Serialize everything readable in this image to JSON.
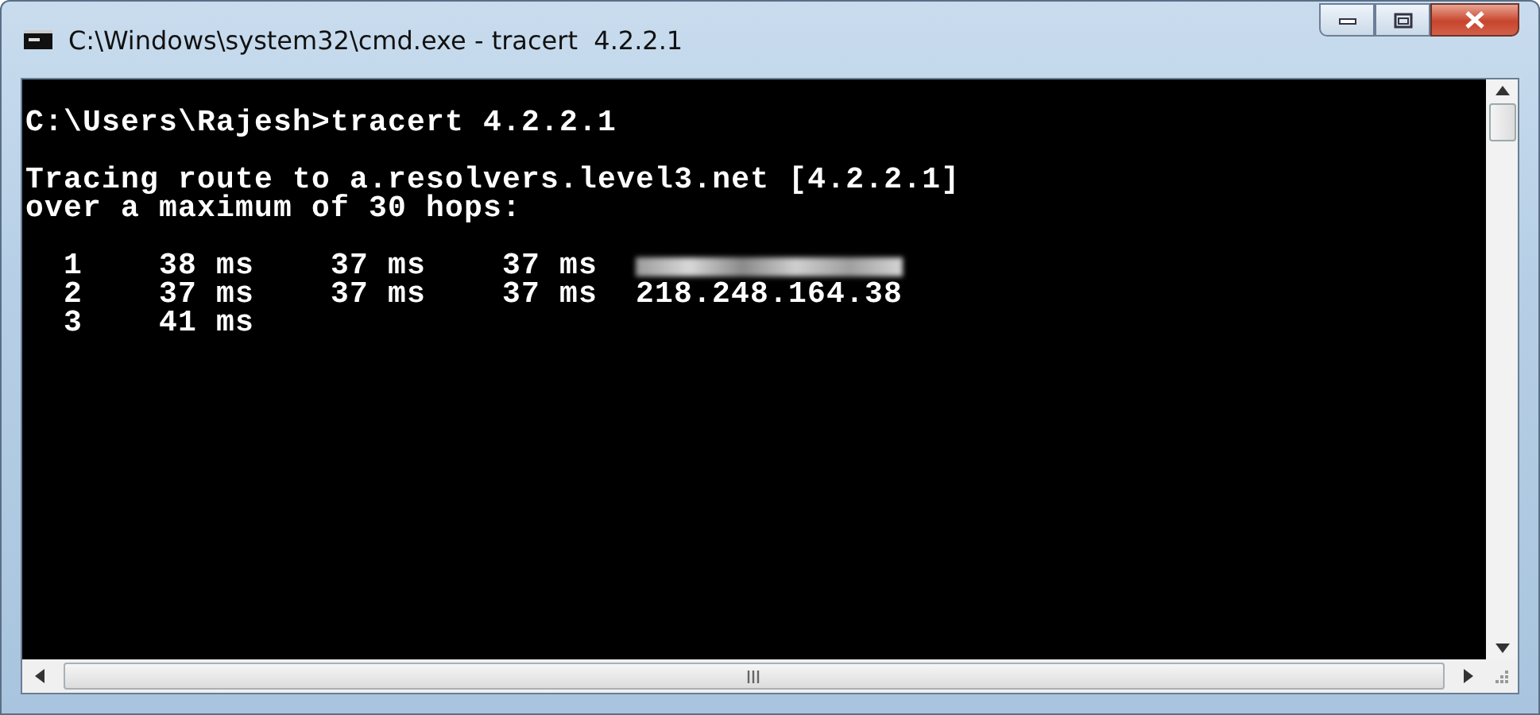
{
  "window": {
    "title": "C:\\Windows\\system32\\cmd.exe - tracert  4.2.2.1"
  },
  "console": {
    "command": "C:\\Users\\Rajesh>tracert 4.2.2.1",
    "header": [
      "Tracing route to a.resolvers.level3.net [4.2.2.1]",
      "over a maximum of 30 hops:"
    ],
    "hops": [
      {
        "hop": "1",
        "times": [
          "38 ms",
          "37 ms",
          "37 ms"
        ],
        "host_hidden": true
      },
      {
        "hop": "2",
        "times": [
          "37 ms",
          "37 ms",
          "37 ms"
        ],
        "host": "218.248.164.38",
        "host_hidden": false
      },
      {
        "hop": "3",
        "times": [
          "41 ms"
        ],
        "host_hidden": false
      }
    ]
  }
}
